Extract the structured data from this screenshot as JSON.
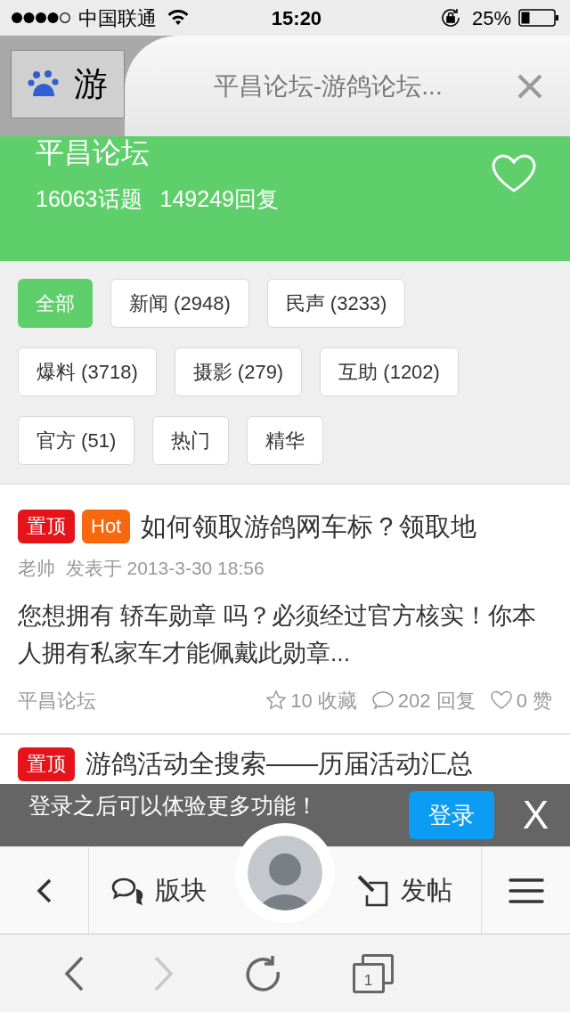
{
  "status_bar": {
    "carrier": "中国联通",
    "time": "15:20",
    "battery": "25%"
  },
  "browser_tabs": [
    {
      "title": "游",
      "selected": false
    },
    {
      "title": "平昌论坛-游鸽论坛...",
      "selected": true
    }
  ],
  "forum": {
    "name": "平昌论坛",
    "topics": "16063话题",
    "replies": "149249回复"
  },
  "filters": [
    {
      "label": "全部",
      "selected": true
    },
    {
      "label": "新闻 (2948)",
      "selected": false
    },
    {
      "label": "民声 (3233)",
      "selected": false
    },
    {
      "label": "爆料 (3718)",
      "selected": false
    },
    {
      "label": "摄影 (279)",
      "selected": false
    },
    {
      "label": "互助 (1202)",
      "selected": false
    },
    {
      "label": "官方 (51)",
      "selected": false
    },
    {
      "label": "热门",
      "selected": false
    },
    {
      "label": "精华",
      "selected": false
    }
  ],
  "posts": [
    {
      "tags": [
        {
          "label": "置顶",
          "color": "#e5141b"
        },
        {
          "label": "Hot",
          "color": "#f8680d"
        }
      ],
      "title": "如何领取游鸽网车标？领取地",
      "meta": "老帅  发表于 2013-3-30 18:56",
      "excerpt": "您想拥有 轿车勋章 吗？必须经过官方核实！你本人拥有私家车才能佩戴此勋章...",
      "forum": "平昌论坛",
      "favorites": "10 收藏",
      "replies": "202 回复",
      "likes": "0 赞"
    },
    {
      "tags": [
        {
          "label": "置顶",
          "color": "#e5141b"
        }
      ],
      "title": "游鸽活动全搜索——历届活动汇总"
    }
  ],
  "login_banner": {
    "message": "登录之后可以体验更多功能！",
    "button": "登录",
    "close": "X"
  },
  "forum_nav": {
    "sections": "版块",
    "new_post": "发帖"
  },
  "browser_toolbar": {
    "forward_disabled": true,
    "tab_count": "1"
  }
}
